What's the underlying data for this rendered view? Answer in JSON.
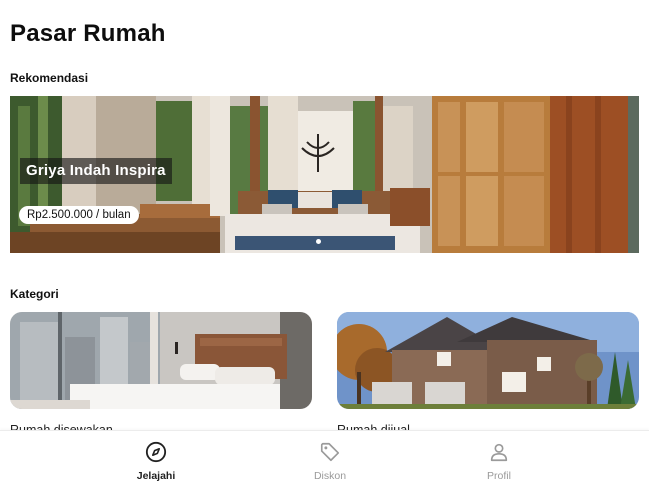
{
  "header": {
    "title": "Pasar Rumah"
  },
  "recommendations": {
    "section_title": "Rekomendasi",
    "featured": {
      "name": "Griya Indah Inspira",
      "price": "Rp2.500.000 / bulan",
      "image_icon": "bedroom-photo"
    },
    "carousel": {
      "total": 1,
      "active_index": 0
    }
  },
  "categories": {
    "section_title": "Kategori",
    "items": [
      {
        "label": "Rumah disewakan",
        "image_icon": "bedroom-photo"
      },
      {
        "label": "Rumah dijual",
        "image_icon": "house-exterior-photo"
      }
    ]
  },
  "bottom_nav": {
    "items": [
      {
        "label": "Jelajahi",
        "icon": "compass-icon",
        "active": true
      },
      {
        "label": "Diskon",
        "icon": "tag-icon",
        "active": false
      },
      {
        "label": "Profil",
        "icon": "person-icon",
        "active": false
      }
    ]
  },
  "colors": {
    "active_nav": "#222222",
    "inactive_nav": "#9a9a9a",
    "background": "#ffffff"
  }
}
